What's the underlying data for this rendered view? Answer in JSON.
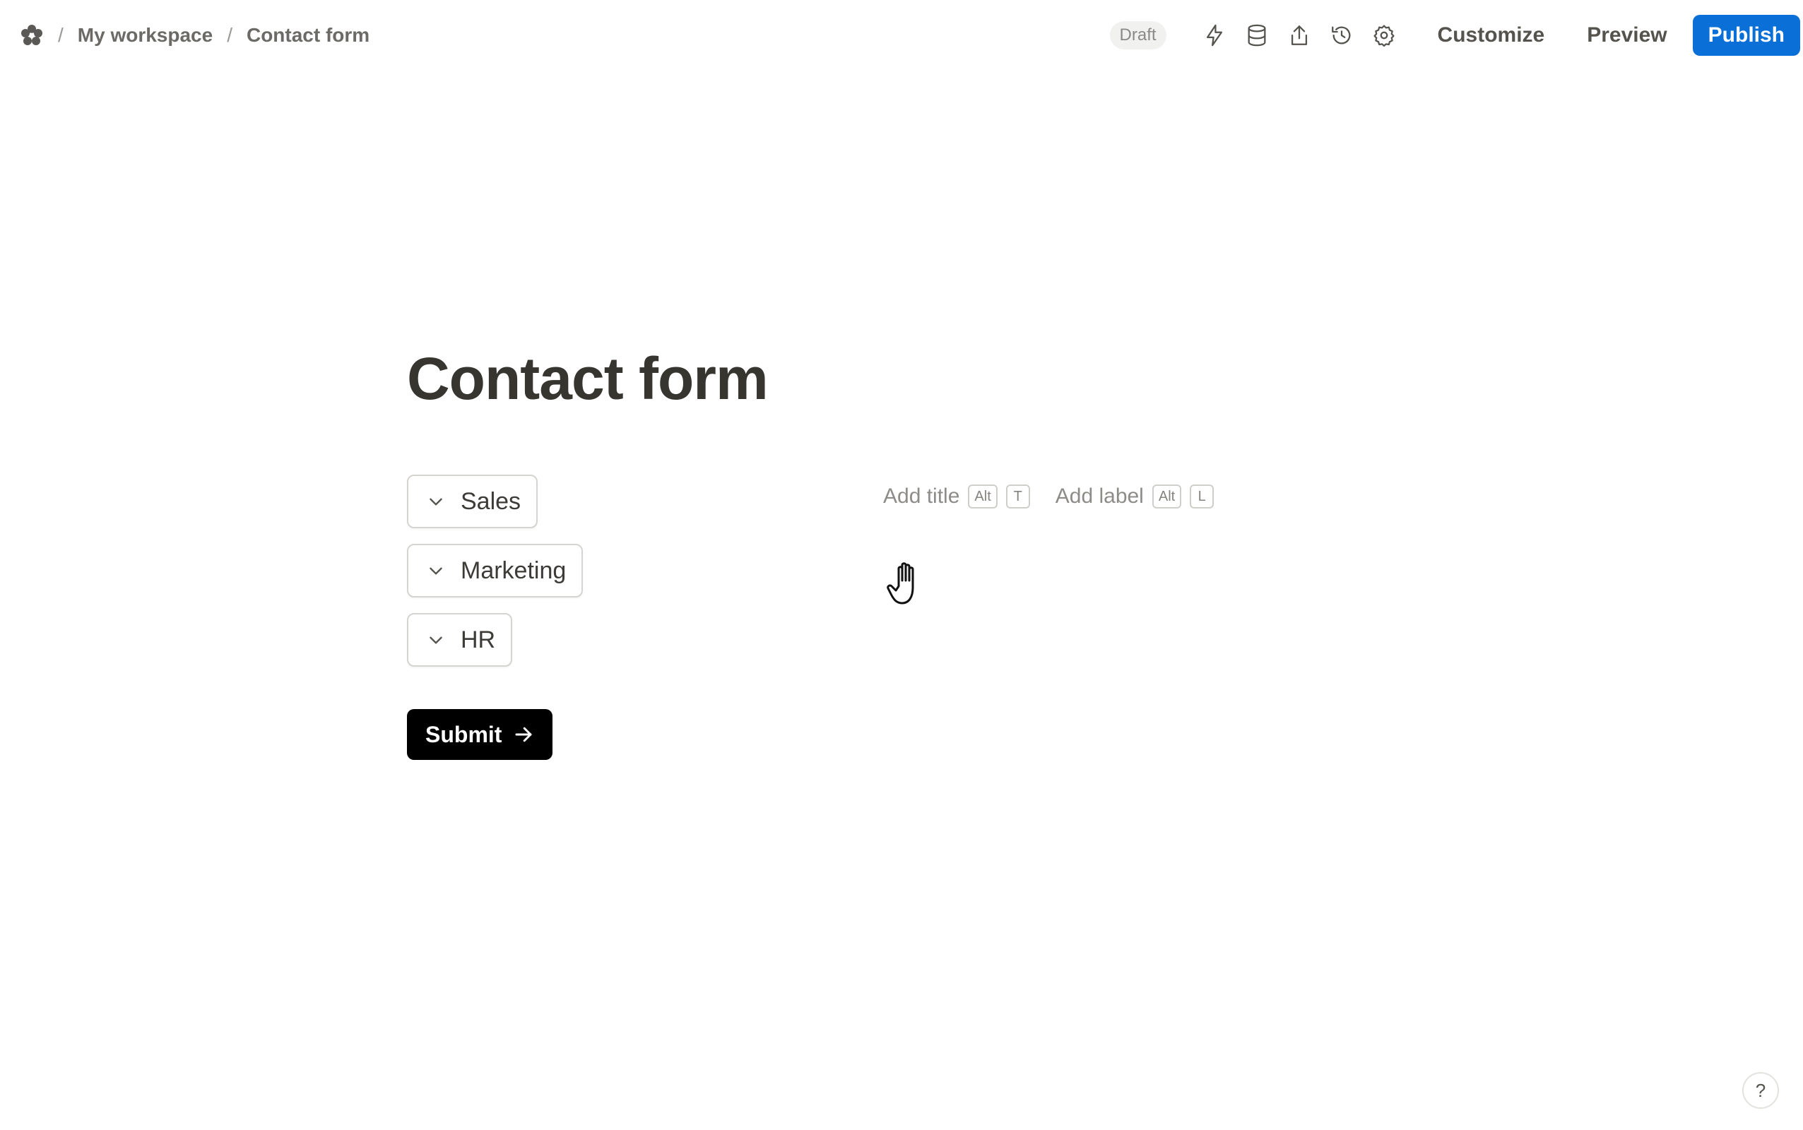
{
  "breadcrumb": {
    "logo_icon": "flower-logo-icon",
    "items": [
      "My workspace",
      "Contact form"
    ]
  },
  "header": {
    "status_badge": "Draft",
    "tools": [
      "lightning-icon",
      "database-icon",
      "share-icon",
      "history-icon",
      "gear-icon"
    ],
    "customize_label": "Customize",
    "preview_label": "Preview",
    "publish_label": "Publish",
    "publish_color": "#0a6fd6"
  },
  "form": {
    "title": "Contact form",
    "options": [
      "Sales",
      "Marketing",
      "HR"
    ],
    "submit_label": "Submit"
  },
  "hints": {
    "add_title": "Add title",
    "add_title_keys": [
      "Alt",
      "T"
    ],
    "add_label": "Add label",
    "add_label_keys": [
      "Alt",
      "L"
    ]
  },
  "help_label": "?"
}
